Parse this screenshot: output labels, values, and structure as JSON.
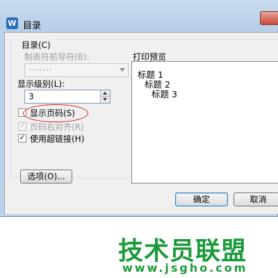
{
  "window": {
    "title": "目录",
    "app_icon_letter": "W"
  },
  "group": {
    "legend": "目录(C)"
  },
  "tab_leader": {
    "label": "制表符前导符(B):",
    "value": "·······"
  },
  "show_levels": {
    "label": "显示级别(L):",
    "value": "3"
  },
  "checkboxes": [
    {
      "label": "显示页码(S)",
      "checked": false,
      "enabled": true
    },
    {
      "label": "页码右对齐(R)",
      "checked": true,
      "enabled": false
    },
    {
      "label": "使用超链接(H)",
      "checked": true,
      "enabled": true
    }
  ],
  "options_button": {
    "label": "选项(O)..."
  },
  "preview": {
    "label": "打印预览",
    "lines": [
      "标题 1",
      "标题 2",
      "标题 3"
    ]
  },
  "buttons": {
    "ok": "确定",
    "cancel": "取消"
  },
  "annotation": {
    "color": "#d21a1a"
  },
  "watermark": {
    "text": "技术员联盟",
    "url": "www.jsgho.com",
    "color": "#1a9a3a"
  }
}
